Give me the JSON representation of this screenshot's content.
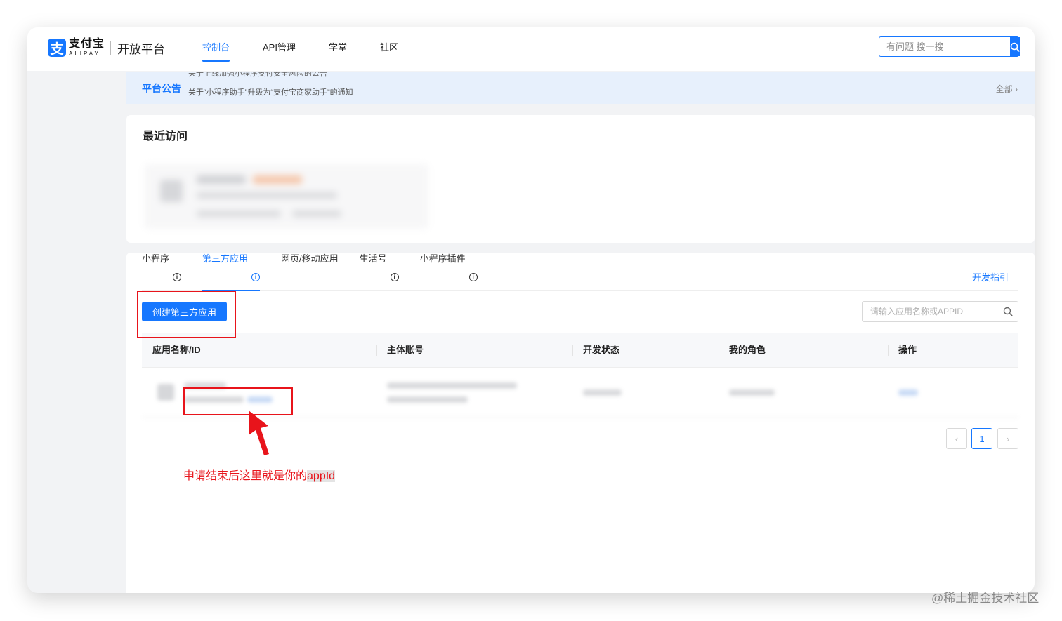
{
  "header": {
    "brand_cn": "支付宝",
    "brand_en": "ALIPAY",
    "platform": "开放平台",
    "nav": [
      {
        "label": "控制台",
        "active": true
      },
      {
        "label": "API管理",
        "active": false
      },
      {
        "label": "学堂",
        "active": false
      },
      {
        "label": "社区",
        "active": false
      }
    ],
    "search_placeholder": "有问题 搜一搜"
  },
  "notice": {
    "title": "平台公告",
    "ghost_line": "关于上线加强小程序支付安全风险的公告",
    "text": "关于“小程序助手”升级为“支付宝商家助手”的通知",
    "all_label": "全部"
  },
  "recent": {
    "title": "最近访问"
  },
  "apps": {
    "tabs": [
      {
        "label": "小程序",
        "info": true,
        "active": false
      },
      {
        "label": "第三方应用",
        "info": true,
        "active": true
      },
      {
        "label": "网页/移动应用",
        "info": false,
        "active": false
      },
      {
        "label": "生活号",
        "info": true,
        "active": false
      },
      {
        "label": "小程序插件",
        "info": true,
        "active": false
      }
    ],
    "dev_guide": "开发指引",
    "create_button": "创建第三方应用",
    "search_placeholder": "请输入应用名称或APPID",
    "columns": [
      "应用名称/ID",
      "主体账号",
      "开发状态",
      "我的角色",
      "操作"
    ],
    "pagination": {
      "prev": "‹",
      "current": "1",
      "next": "›"
    }
  },
  "annotation": {
    "text_main": "申请结束后这里就是你的",
    "text_highlight": "appId",
    "color": "#e8141b"
  },
  "watermark": "@稀土掘金技术社区",
  "colors": {
    "accent": "#1677ff",
    "annotation": "#e8141b"
  }
}
